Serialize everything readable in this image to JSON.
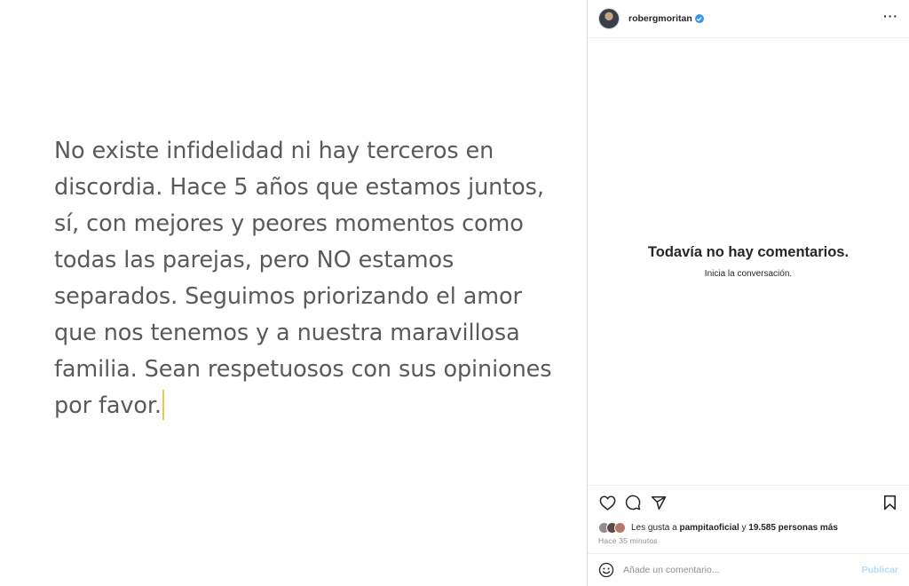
{
  "post": {
    "text_lines": [
      "No existe infidelidad ni hay terceros en",
      "discordia. Hace 5 años que estamos juntos,",
      "sí, con mejores y peores momentos como",
      "todas las parejas, pero NO estamos",
      "separados. Seguimos priorizando el amor",
      "que nos tenemos y a nuestra maravillosa",
      "familia. Sean respetuosos con sus opiniones",
      "por favor."
    ]
  },
  "header": {
    "username": "robergmoritan",
    "verified_icon": "verified-badge-icon",
    "more_icon": "more-options-icon",
    "more_glyph": "···"
  },
  "comments": {
    "empty_title": "Todavía no hay comentarios.",
    "empty_subtitle": "Inicia la conversación."
  },
  "actions": {
    "icons": [
      "heart-icon",
      "comment-icon",
      "share-icon",
      "bookmark-icon"
    ]
  },
  "likes": {
    "prefix": "Les gusta a ",
    "user": "pampitaoficial",
    "connector": " y ",
    "count_text": "19.585 personas más"
  },
  "timestamp": "Hace 35 minutos",
  "comment_box": {
    "placeholder": "Añade un comentario...",
    "publish_label": "Publicar"
  },
  "colors": {
    "accent_blue": "#3897f0",
    "publish_disabled": "#b3dbff",
    "caret": "#f2c14e"
  }
}
